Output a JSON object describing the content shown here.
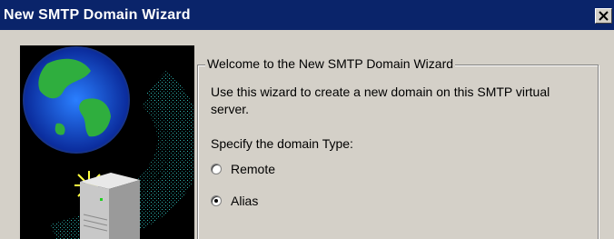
{
  "window": {
    "title": "New SMTP Domain Wizard",
    "close_icon": "close-icon"
  },
  "art": {
    "icons": [
      "globe-icon",
      "server-icon",
      "sparkle-icon"
    ]
  },
  "group": {
    "title": "Welcome to the New SMTP Domain Wizard",
    "description": "Use this wizard to create a new domain on this SMTP virtual server.",
    "prompt": "Specify the domain Type:"
  },
  "domain_type": {
    "options": [
      {
        "label": "Remote",
        "checked": false
      },
      {
        "label": "Alias",
        "checked": true
      }
    ]
  },
  "colors": {
    "titlebar": "#0a246a",
    "face": "#d4d0c8"
  }
}
